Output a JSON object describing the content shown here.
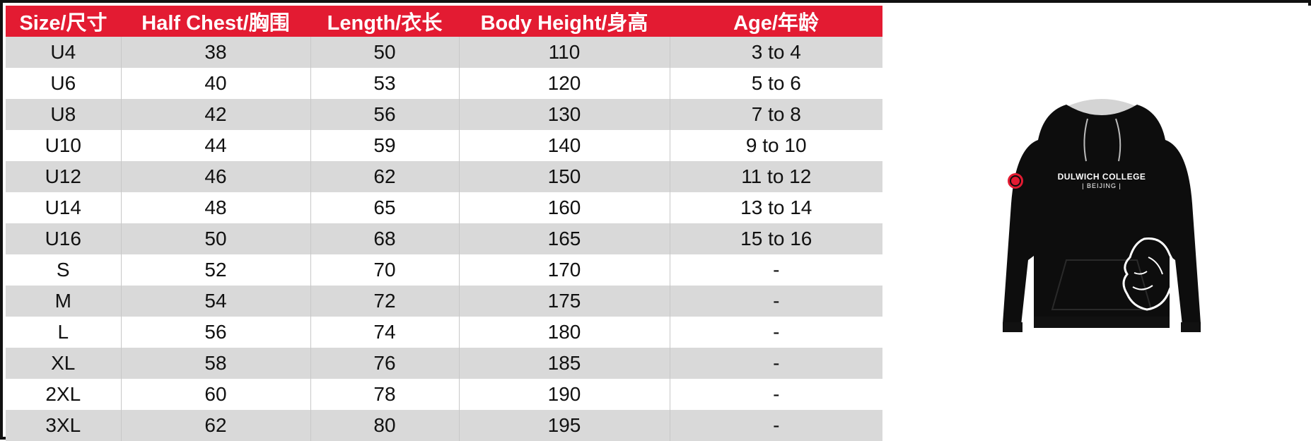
{
  "table": {
    "headers": [
      "Size/尺寸",
      "Half Chest/胸围",
      "Length/衣长",
      "Body Height/身高",
      "Age/年龄"
    ],
    "rows": [
      [
        "U4",
        "38",
        "50",
        "110",
        "3 to 4"
      ],
      [
        "U6",
        "40",
        "53",
        "120",
        "5 to 6"
      ],
      [
        "U8",
        "42",
        "56",
        "130",
        "7 to 8"
      ],
      [
        "U10",
        "44",
        "59",
        "140",
        "9 to 10"
      ],
      [
        "U12",
        "46",
        "62",
        "150",
        "11 to 12"
      ],
      [
        "U14",
        "48",
        "65",
        "160",
        "13 to 14"
      ],
      [
        "U16",
        "50",
        "68",
        "165",
        "15 to 16"
      ],
      [
        "S",
        "52",
        "70",
        "170",
        "-"
      ],
      [
        "M",
        "54",
        "72",
        "175",
        "-"
      ],
      [
        "L",
        "56",
        "74",
        "180",
        "-"
      ],
      [
        "XL",
        "58",
        "76",
        "185",
        "-"
      ],
      [
        "2XL",
        "60",
        "78",
        "190",
        "-"
      ],
      [
        "3XL",
        "62",
        "80",
        "195",
        "-"
      ]
    ]
  },
  "product_image": {
    "icon": "hoodie-icon",
    "print_line_1": "DULWICH COLLEGE",
    "print_line_2": "| BEIJING |"
  },
  "colors": {
    "header_bg": "#e31b32",
    "header_text": "#ffffff",
    "row_shaded": "#d9d9d9",
    "row_plain": "#ffffff",
    "hoodie_body": "#0d0d0d",
    "hood_lining": "#d4d4d4",
    "sleeve_badge": "#e31b32"
  }
}
